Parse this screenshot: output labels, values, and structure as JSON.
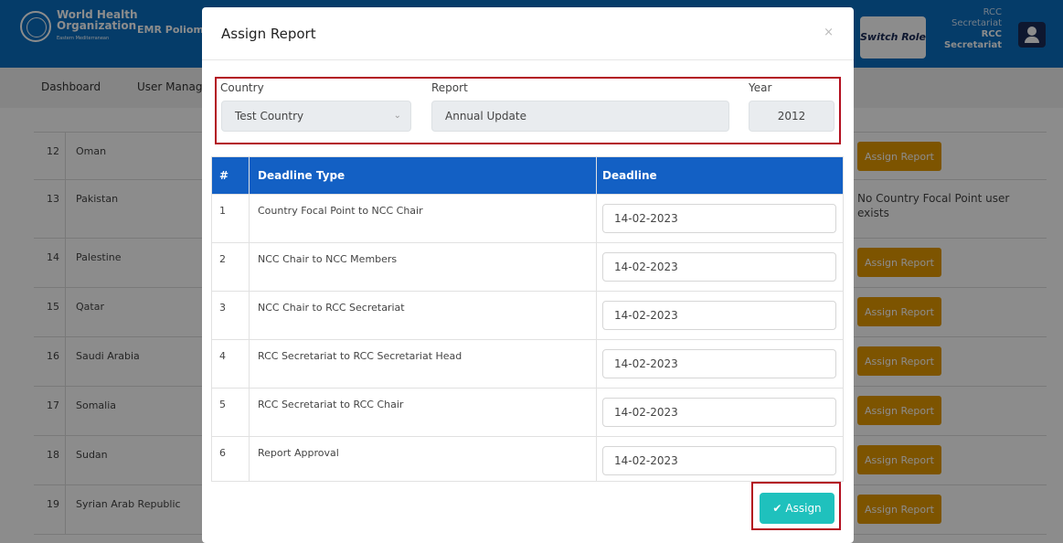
{
  "header": {
    "org_line1": "World Health",
    "org_line2": "Organization",
    "org_region": "Eastern Mediterranean",
    "app_name": "EMR Poliom",
    "switch_role_label": "Switch Role",
    "role_line1": "RCC Secretariat",
    "role_line2": "RCC Secretariat",
    "colors": {
      "primary": "#0a6ec0",
      "dark": "#1a2b57"
    }
  },
  "nav": {
    "items": [
      "Dashboard",
      "User Manag"
    ]
  },
  "background_table": {
    "rows": [
      {
        "num": "12",
        "country": "Oman",
        "action": "Assign Report"
      },
      {
        "num": "13",
        "country": "Pakistan",
        "action": "No Country Focal Point user exists"
      },
      {
        "num": "14",
        "country": "Palestine",
        "action": "Assign Report"
      },
      {
        "num": "15",
        "country": "Qatar",
        "action": "Assign Report"
      },
      {
        "num": "16",
        "country": "Saudi Arabia",
        "action": "Assign Report"
      },
      {
        "num": "17",
        "country": "Somalia",
        "action": "Assign Report"
      },
      {
        "num": "18",
        "country": "Sudan",
        "action": "Assign Report"
      },
      {
        "num": "19",
        "country": "Syrian Arab Republic",
        "action": "Assign Report"
      }
    ],
    "action_color": "#e39a00"
  },
  "modal": {
    "title": "Assign Report",
    "close_glyph": "×",
    "country_label": "Country",
    "country_value": "Test Country",
    "report_label": "Report",
    "report_value": "Annual Update",
    "year_label": "Year",
    "year_value": "2012",
    "table": {
      "headers": [
        "#",
        "Deadline Type",
        "Deadline"
      ],
      "rows": [
        {
          "num": "1",
          "type": "Country Focal Point to NCC Chair",
          "deadline": "14-02-2023"
        },
        {
          "num": "2",
          "type": "NCC Chair to NCC Members",
          "deadline": "14-02-2023"
        },
        {
          "num": "3",
          "type": "NCC Chair to RCC Secretariat",
          "deadline": "14-02-2023"
        },
        {
          "num": "4",
          "type": "RCC Secretariat to RCC Secretariat Head",
          "deadline": "14-02-2023"
        },
        {
          "num": "5",
          "type": "RCC Secretariat to RCC Chair",
          "deadline": "14-02-2023"
        },
        {
          "num": "6",
          "type": "Report Approval",
          "deadline": "14-02-2023"
        }
      ],
      "header_color": "#1360c4"
    },
    "assign_label": "Assign",
    "assign_color": "#1fc1bd",
    "highlight_color": "#b30f1f"
  }
}
